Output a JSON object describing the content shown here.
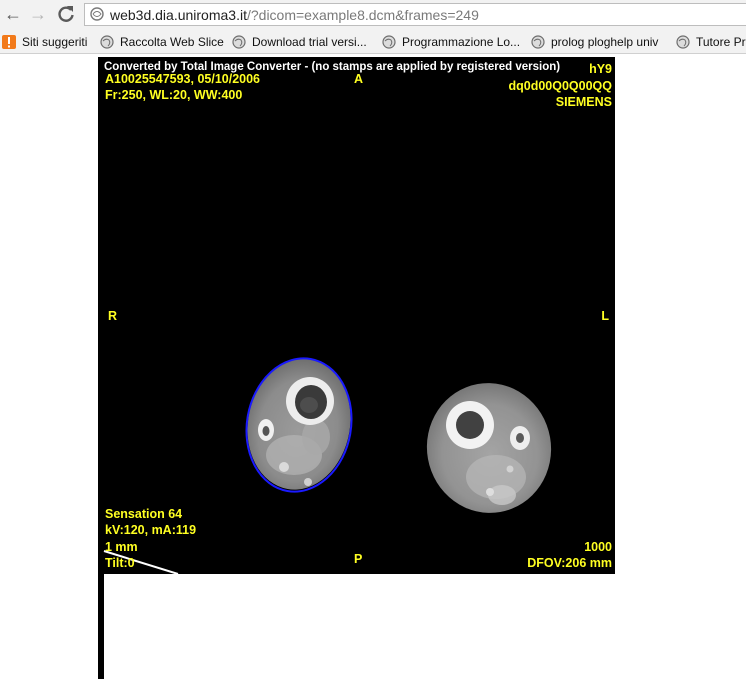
{
  "browser": {
    "url_host": "web3d.dia.uniroma3.it",
    "url_path": "/?dicom=example8.dcm&frames=249",
    "bookmarks": [
      {
        "label": "Siti suggeriti",
        "icon": "suggested-sites-icon"
      },
      {
        "label": "Raccolta Web Slice",
        "icon": "globe-icon"
      },
      {
        "label": "Download trial versi...",
        "icon": "globe-icon"
      },
      {
        "label": "Programmazione Lo...",
        "icon": "globe-icon"
      },
      {
        "label": "prolog ploghelp univ",
        "icon": "globe-icon"
      },
      {
        "label": "Tutore Pr",
        "icon": "globe-icon"
      }
    ]
  },
  "dicom": {
    "watermark": "Converted by Total Image Converter - (no stamps are applied by registered version)",
    "top_left": [
      "A10025547593, 05/10/2006",
      "Fr:250, WL:20, WW:400"
    ],
    "top_right": [
      "hY9",
      "dq0d00Q0Q00QQ",
      "SIEMENS"
    ],
    "orientation": {
      "top": "A",
      "bottom": "P",
      "left": "R",
      "right": "L"
    },
    "bottom_left": [
      "Sensation 64",
      "kV:120, mA:119",
      "1 mm",
      "Tilt:0"
    ],
    "bottom_right": [
      "1000",
      "DFOV:206 mm"
    ],
    "roi_color": "#1a1aff",
    "overlay_color": "#ffff22"
  }
}
